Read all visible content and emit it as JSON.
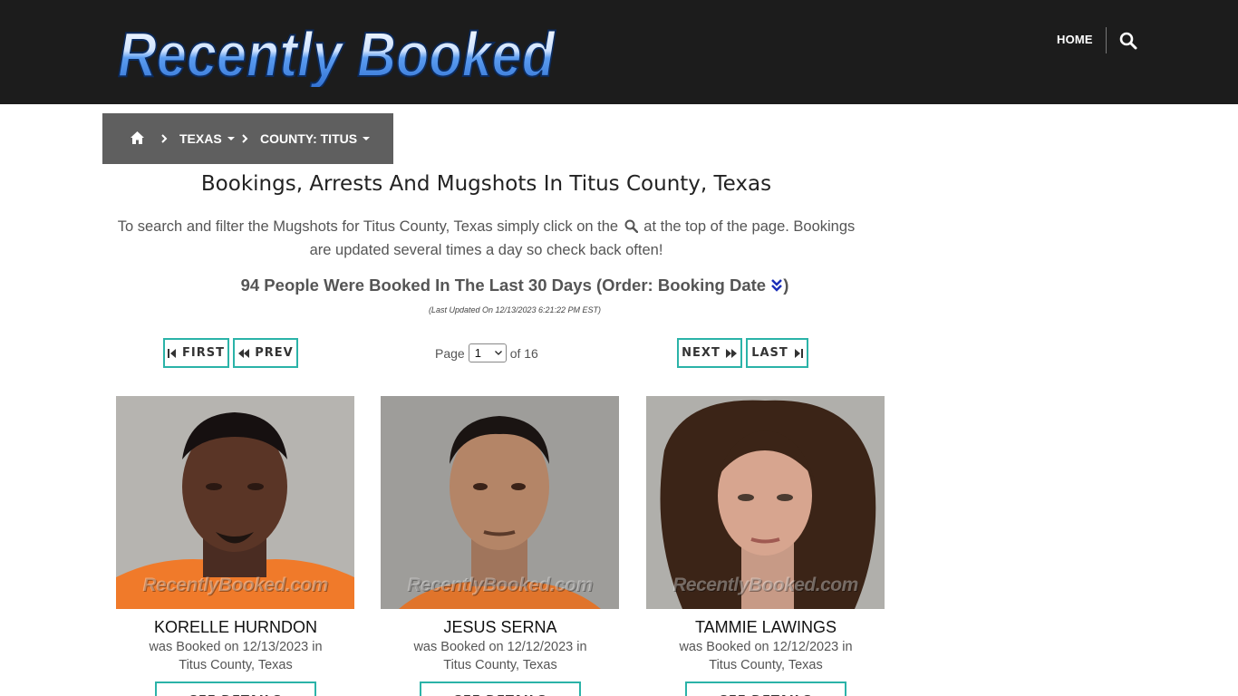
{
  "brand": {
    "logo_text": "Recently Booked"
  },
  "nav": {
    "home_label": "HOME",
    "search_icon": "search-icon"
  },
  "breadcrumb": {
    "home_icon": "home-icon",
    "state": "TEXAS",
    "county": "COUNTY: TITUS"
  },
  "page": {
    "title": "Bookings, Arrests And Mugshots In Titus County, Texas",
    "intro_before": "To search and filter the Mugshots for Titus County, Texas simply click on the",
    "intro_after": "at the top of the page. Bookings",
    "intro_line2": "are updated several times a day so check back often!",
    "count_text": "94 People Were Booked In The Last 30 Days (Order: Booking Date",
    "count_close": ")",
    "updated": "(Last Updated On 12/13/2023 6:21:22 PM EST)"
  },
  "pagination": {
    "first_label": "FIRST",
    "prev_label": "PREV",
    "next_label": "NEXT",
    "last_label": "LAST",
    "page_word": "Page",
    "current_page": "1",
    "of_text": "of 16"
  },
  "colors": {
    "header_bg": "#1c1c1c",
    "breadcrumb_bg": "#5f5f5f",
    "accent": "#2bb3a8"
  },
  "bookings": [
    {
      "name": "KORELLE HURNDON",
      "line1": "was Booked on 12/13/2023 in",
      "line2": "Titus County, Texas",
      "button": "SEE DETAILS",
      "watermark": "RecentlyBooked.com"
    },
    {
      "name": "JESUS SERNA",
      "line1": "was Booked on 12/12/2023 in",
      "line2": "Titus County, Texas",
      "button": "SEE DETAILS",
      "watermark": "RecentlyBooked.com"
    },
    {
      "name": "TAMMIE LAWINGS",
      "line1": "was Booked on 12/12/2023 in",
      "line2": "Titus County, Texas",
      "button": "SEE DETAILS",
      "watermark": "RecentlyBooked.com"
    }
  ]
}
